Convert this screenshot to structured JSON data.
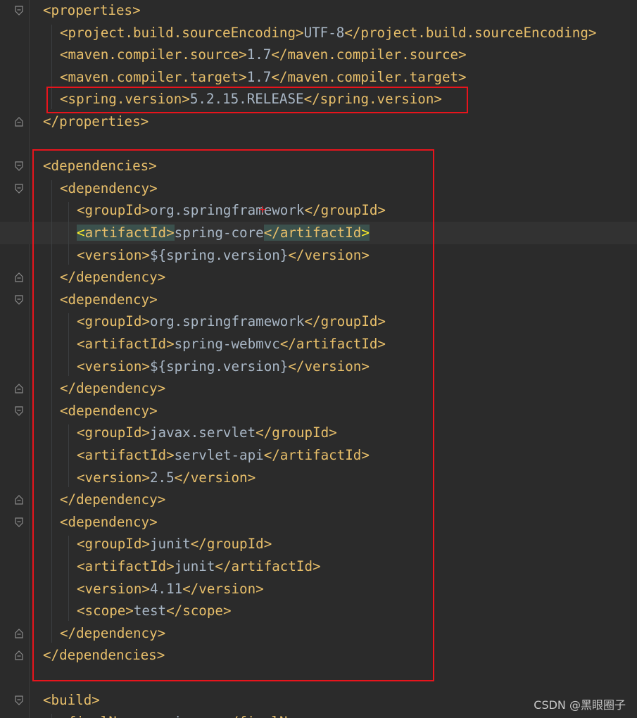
{
  "lines": [
    {
      "parts": [
        {
          "t": "<properties>",
          "c": "tag"
        }
      ]
    },
    {
      "parts": [
        {
          "t": "<project.build.sourceEncoding>",
          "c": "tag"
        },
        {
          "t": "UTF-8",
          "c": "val"
        },
        {
          "t": "</project.build.sourceEncoding>",
          "c": "tag"
        }
      ]
    },
    {
      "parts": [
        {
          "t": "<maven.compiler.source>",
          "c": "tag"
        },
        {
          "t": "1.7",
          "c": "val"
        },
        {
          "t": "</maven.compiler.source>",
          "c": "tag"
        }
      ]
    },
    {
      "parts": [
        {
          "t": "<maven.compiler.target>",
          "c": "tag"
        },
        {
          "t": "1.7",
          "c": "val"
        },
        {
          "t": "</maven.compiler.target>",
          "c": "tag"
        }
      ]
    },
    {
      "parts": [
        {
          "t": "<spring.version>",
          "c": "tag"
        },
        {
          "t": "5.2.15.RELEASE",
          "c": "val"
        },
        {
          "t": "</spring.version>",
          "c": "tag"
        }
      ]
    },
    {
      "parts": [
        {
          "t": "</properties>",
          "c": "tag"
        }
      ]
    },
    {
      "parts": []
    },
    {
      "parts": [
        {
          "t": "<dependencies>",
          "c": "tag"
        }
      ]
    },
    {
      "parts": [
        {
          "t": "<dependency>",
          "c": "tag"
        }
      ]
    },
    {
      "parts": [
        {
          "t": "<groupId>",
          "c": "tag"
        },
        {
          "t": "org.springframework",
          "c": "val"
        },
        {
          "t": "</groupId>",
          "c": "tag"
        }
      ]
    },
    {
      "parts": [
        {
          "t": "<artifactId>",
          "c": "tag"
        },
        {
          "t": "spring-core",
          "c": "val"
        },
        {
          "t": "</artifactId>",
          "c": "tag"
        }
      ]
    },
    {
      "parts": [
        {
          "t": "<version>",
          "c": "tag"
        },
        {
          "t": "${spring.version}",
          "c": "val"
        },
        {
          "t": "</version>",
          "c": "tag"
        }
      ]
    },
    {
      "parts": [
        {
          "t": "</dependency>",
          "c": "tag"
        }
      ]
    },
    {
      "parts": [
        {
          "t": "<dependency>",
          "c": "tag"
        }
      ]
    },
    {
      "parts": [
        {
          "t": "<groupId>",
          "c": "tag"
        },
        {
          "t": "org.springframework",
          "c": "val"
        },
        {
          "t": "</groupId>",
          "c": "tag"
        }
      ]
    },
    {
      "parts": [
        {
          "t": "<artifactId>",
          "c": "tag"
        },
        {
          "t": "spring-webmvc",
          "c": "val"
        },
        {
          "t": "</artifactId>",
          "c": "tag"
        }
      ]
    },
    {
      "parts": [
        {
          "t": "<version>",
          "c": "tag"
        },
        {
          "t": "${spring.version}",
          "c": "val"
        },
        {
          "t": "</version>",
          "c": "tag"
        }
      ]
    },
    {
      "parts": [
        {
          "t": "</dependency>",
          "c": "tag"
        }
      ]
    },
    {
      "parts": [
        {
          "t": "<dependency>",
          "c": "tag"
        }
      ]
    },
    {
      "parts": [
        {
          "t": "<groupId>",
          "c": "tag"
        },
        {
          "t": "javax.servlet",
          "c": "val"
        },
        {
          "t": "</groupId>",
          "c": "tag"
        }
      ]
    },
    {
      "parts": [
        {
          "t": "<artifactId>",
          "c": "tag"
        },
        {
          "t": "servlet-api",
          "c": "val"
        },
        {
          "t": "</artifactId>",
          "c": "tag"
        }
      ]
    },
    {
      "parts": [
        {
          "t": "<version>",
          "c": "tag"
        },
        {
          "t": "2.5",
          "c": "val"
        },
        {
          "t": "</version>",
          "c": "tag"
        }
      ]
    },
    {
      "parts": [
        {
          "t": "</dependency>",
          "c": "tag"
        }
      ]
    },
    {
      "parts": [
        {
          "t": "<dependency>",
          "c": "tag"
        }
      ]
    },
    {
      "parts": [
        {
          "t": "<groupId>",
          "c": "tag"
        },
        {
          "t": "junit",
          "c": "val"
        },
        {
          "t": "</groupId>",
          "c": "tag"
        }
      ]
    },
    {
      "parts": [
        {
          "t": "<artifactId>",
          "c": "tag"
        },
        {
          "t": "junit",
          "c": "val"
        },
        {
          "t": "</artifactId>",
          "c": "tag"
        }
      ]
    },
    {
      "parts": [
        {
          "t": "<version>",
          "c": "tag"
        },
        {
          "t": "4.11",
          "c": "val"
        },
        {
          "t": "</version>",
          "c": "tag"
        }
      ]
    },
    {
      "parts": [
        {
          "t": "<scope>",
          "c": "tag"
        },
        {
          "t": "test",
          "c": "val"
        },
        {
          "t": "</scope>",
          "c": "tag"
        }
      ]
    },
    {
      "parts": [
        {
          "t": "</dependency>",
          "c": "tag"
        }
      ]
    },
    {
      "parts": [
        {
          "t": "</dependencies>",
          "c": "tag"
        }
      ]
    },
    {
      "parts": []
    },
    {
      "parts": [
        {
          "t": "<build>",
          "c": "tag"
        }
      ]
    },
    {
      "parts": [
        {
          "t": "<finalName>",
          "c": "tag"
        },
        {
          "t": "springmvc",
          "c": "val"
        },
        {
          "t": "</finalName>",
          "c": "tag"
        }
      ]
    }
  ],
  "watermark": "CSDN @黑眼圈子",
  "colors": {
    "background": "#2b2b2b",
    "tag": "#e8bf6a",
    "text": "#a9b7c6",
    "highlight_box": "#e8141c",
    "matched_tag_bg": "#3b514d"
  }
}
